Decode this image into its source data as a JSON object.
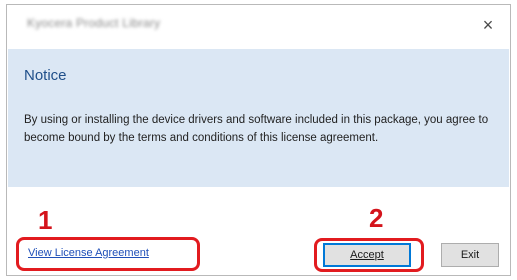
{
  "window": {
    "title": "Kyocera Product Library",
    "close_glyph": "×"
  },
  "notice": {
    "heading": "Notice",
    "body": "By using or installing the device drivers and software included in this package, you agree to become bound by the terms and conditions of this license agreement."
  },
  "footer": {
    "link_label": "View License Agreement",
    "accept_label": "Accept",
    "exit_label": "Exit"
  },
  "annotations": {
    "step_1": "1",
    "step_2": "2",
    "highlight_color": "#e21b1f"
  },
  "colors": {
    "content_background": "#dbe7f4",
    "heading": "#1f4f8a",
    "link": "#1f4fb8",
    "button_focus_border": "#0078d7"
  },
  "icons": {
    "close": "close-icon"
  }
}
